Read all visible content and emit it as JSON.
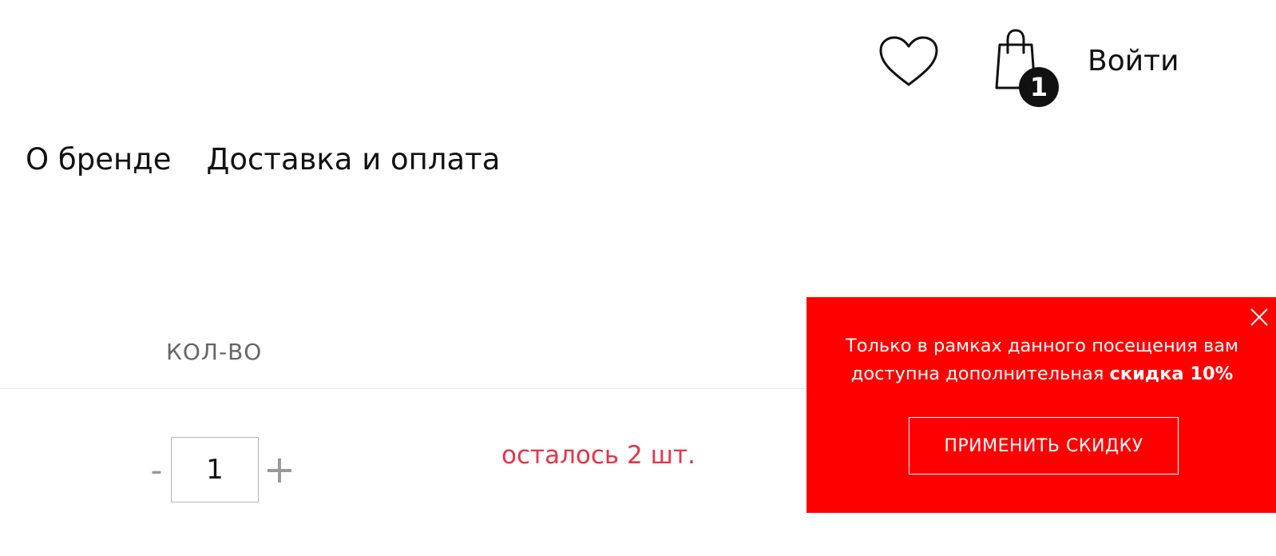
{
  "header": {
    "wishlist_icon": "heart-icon",
    "cart_icon": "shopping-bag-icon",
    "cart_count": "1",
    "login_label": "Войти"
  },
  "nav": {
    "items": [
      {
        "label": "О бренде"
      },
      {
        "label": "Доставка и оплата"
      }
    ]
  },
  "cart_table": {
    "column_header": "КОЛ-ВО",
    "quantity": {
      "minus_label": "-",
      "value": "1",
      "plus_label": "+"
    },
    "stock_note": "осталось 2 шт."
  },
  "promo": {
    "text_before": "Только в рамках данного посещения вам доступна дополнительная",
    "text_bold": "скидка 10%",
    "button_label": "ПРИМЕНИТЬ СКИДКУ",
    "close_icon": "close-icon",
    "background_color": "#ff0000",
    "text_color": "#ffffff"
  },
  "colors": {
    "stock_note": "#e8324a",
    "muted": "#999999"
  }
}
